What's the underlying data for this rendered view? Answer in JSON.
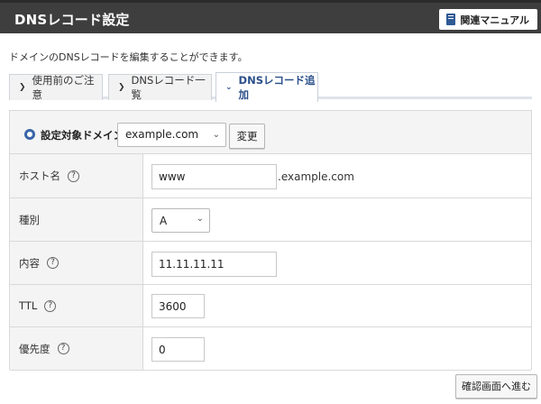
{
  "header": {
    "title": "DNSレコード設定",
    "manual_button": "関連マニュアル",
    "manual_icon": "book-icon"
  },
  "description": "ドメインのDNSレコードを編集することができます。",
  "tabs": [
    {
      "label": "使用前のご注意",
      "active": false
    },
    {
      "label": "DNSレコード一覧",
      "active": false
    },
    {
      "label": "DNSレコード追加",
      "active": true
    }
  ],
  "domain": {
    "label": "設定対象ドメイン",
    "selected": "example.com",
    "change_button": "変更"
  },
  "form": {
    "host": {
      "label": "ホスト名",
      "value": "www",
      "suffix": ".example.com"
    },
    "type": {
      "label": "種別",
      "selected": "A"
    },
    "content": {
      "label": "内容",
      "value": "11.11.11.11"
    },
    "ttl": {
      "label": "TTL",
      "value": "3600"
    },
    "priority": {
      "label": "優先度",
      "value": "0"
    }
  },
  "help_glyph": "?",
  "confirm_button": "確認画面へ進む",
  "colors": {
    "header_bg": "#3e3e3e",
    "accent": "#2a4f8a",
    "label_bg": "#f4f4f4"
  }
}
